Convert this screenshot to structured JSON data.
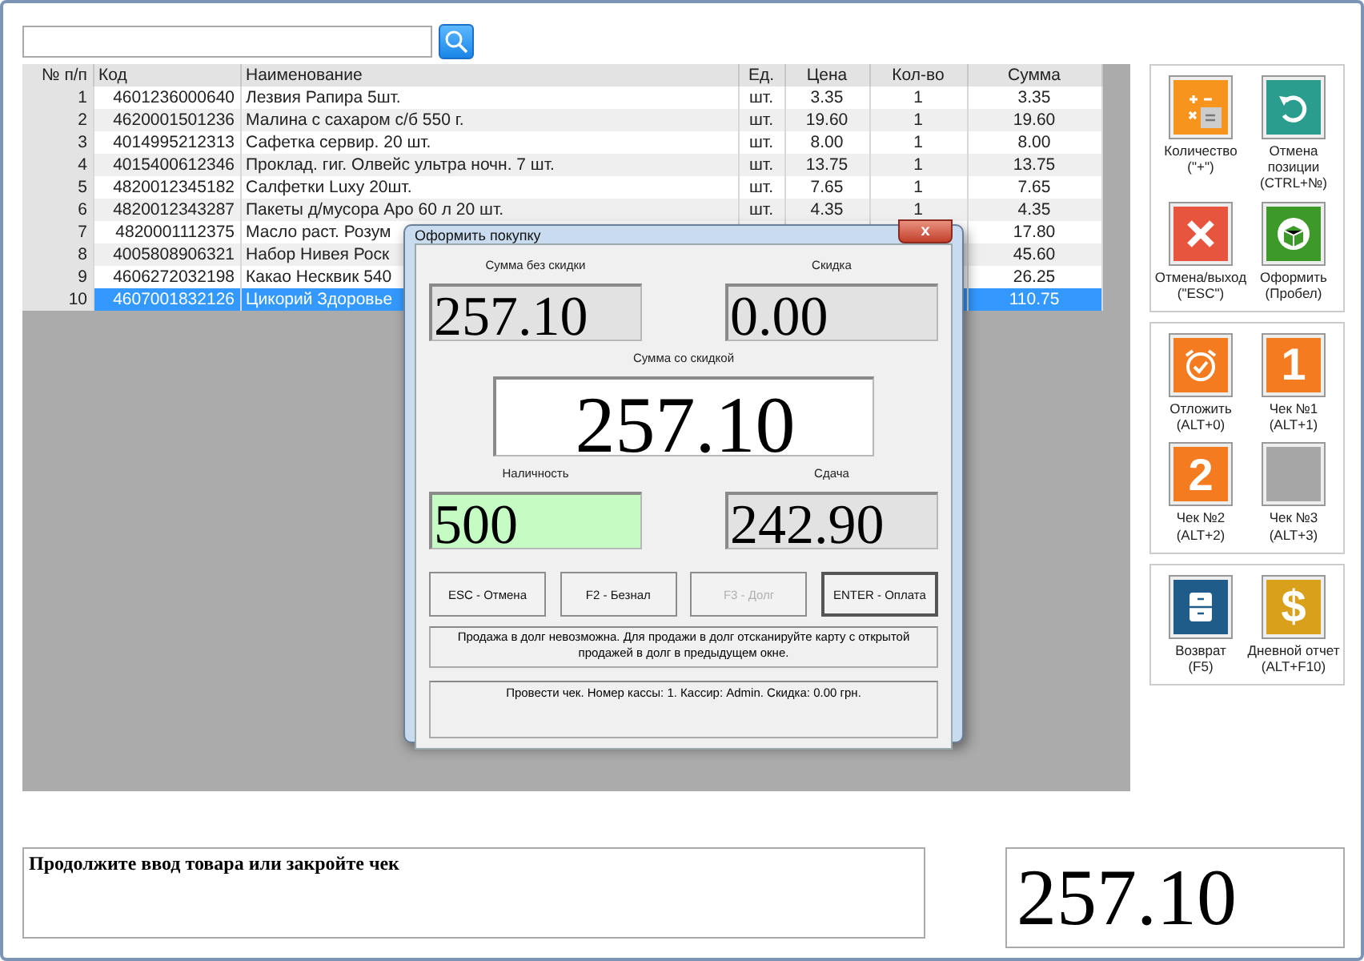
{
  "table": {
    "columns": [
      "№ п/п",
      "Код",
      "Наименование",
      "Ед.",
      "Цена",
      "Кол-во",
      "Сумма"
    ],
    "rows": [
      {
        "no": "1",
        "code": "4601236000640",
        "name": "Лезвия Рапира 5шт.",
        "unit": "шт.",
        "price": "3.35",
        "qty": "1",
        "sum": "3.35",
        "selected": false
      },
      {
        "no": "2",
        "code": "4620001501236",
        "name": "Малина с сахаром с/б 550 г.",
        "unit": "шт.",
        "price": "19.60",
        "qty": "1",
        "sum": "19.60",
        "selected": false
      },
      {
        "no": "3",
        "code": "4014995212313",
        "name": "Сафетка сервир. 20 шт.",
        "unit": "шт.",
        "price": "8.00",
        "qty": "1",
        "sum": "8.00",
        "selected": false
      },
      {
        "no": "4",
        "code": "4015400612346",
        "name": "Проклад. гиг. Олвейс ультра ночн. 7 шт.",
        "unit": "шт.",
        "price": "13.75",
        "qty": "1",
        "sum": "13.75",
        "selected": false
      },
      {
        "no": "5",
        "code": "4820012345182",
        "name": "Салфетки Luxy 20шт.",
        "unit": "шт.",
        "price": "7.65",
        "qty": "1",
        "sum": "7.65",
        "selected": false
      },
      {
        "no": "6",
        "code": "4820012343287",
        "name": "Пакеты д/мусора Аро 60 л 20 шт.",
        "unit": "шт.",
        "price": "4.35",
        "qty": "1",
        "sum": "4.35",
        "selected": false
      },
      {
        "no": "7",
        "code": "4820001112375",
        "name": "Масло раст. Розум",
        "sum": "17.80",
        "selected": false
      },
      {
        "no": "8",
        "code": "4005808906321",
        "name": "Набор Нивея Роск",
        "sum": "45.60",
        "selected": false
      },
      {
        "no": "9",
        "code": "4606272032198",
        "name": "Какао Несквик 540",
        "sum": "26.25",
        "selected": false
      },
      {
        "no": "10",
        "code": "4607001832126",
        "name": "Цикорий Здоровье",
        "sum": "110.75",
        "selected": true
      }
    ]
  },
  "actions": [
    [
      {
        "label": "Количество",
        "hotkey": "(\"+\")"
      },
      {
        "label": "Отмена позиции",
        "hotkey": "(CTRL+№)"
      },
      {
        "label": "Отмена/выход",
        "hotkey": "(\"ESC\")"
      },
      {
        "label": "Оформить",
        "hotkey": "(Пробел)"
      }
    ],
    [
      {
        "label": "Отложить",
        "hotkey": "(ALT+0)"
      },
      {
        "glyph": "1",
        "label": "Чек №1",
        "hotkey": "(ALT+1)"
      },
      {
        "glyph": "2",
        "label": "Чек №2",
        "hotkey": "(ALT+2)"
      },
      {
        "label": "Чек №3",
        "hotkey": "(ALT+3)"
      }
    ],
    [
      {
        "label": "Возврат",
        "hotkey": "(F5)"
      },
      {
        "glyph": "$",
        "label": "Дневной отчет",
        "hotkey": "(ALT+F10)"
      }
    ]
  ],
  "message": "Продолжите ввод товара или закройте чек",
  "total": "257.10",
  "dialog": {
    "title": "Оформить покупку",
    "close": "x",
    "fields": [
      {
        "kind": "readonly",
        "label": "Сумма без скидки",
        "value": "257.10"
      },
      {
        "kind": "readonly",
        "label": "Скидка",
        "value": "0.00"
      },
      {
        "kind": "total",
        "label": "Сумма со скидкой",
        "value": "257.10"
      },
      {
        "kind": "input",
        "label": "Наличность",
        "value": "500"
      },
      {
        "kind": "readonly",
        "label": "Сдача",
        "value": "242.90"
      }
    ],
    "buttons": [
      {
        "label": "ESC - Отмена",
        "disabled": false,
        "default": false
      },
      {
        "label": "F2 - Безнал",
        "disabled": false,
        "default": false
      },
      {
        "label": "F3 - Долг",
        "disabled": true,
        "default": false
      },
      {
        "label": "ENTER - Оплата",
        "disabled": false,
        "default": true
      }
    ],
    "notice": "Продажа в долг невозможна. Для продажи в долг отсканируйте карту с открытой продажей в долг в предыдущем окне.",
    "status": "Провести чек. Номер кассы: 1. Кассир: Admin. Скидка: 0.00 грн."
  }
}
